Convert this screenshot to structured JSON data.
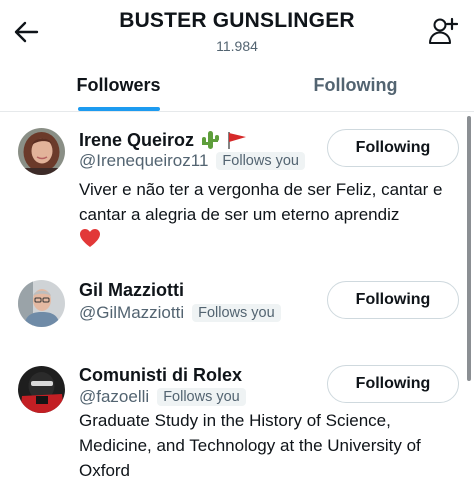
{
  "header": {
    "title": "BUSTER GUNSLINGER",
    "subtitle": "11.984"
  },
  "tabs": [
    {
      "label": "Followers",
      "active": true
    },
    {
      "label": "Following",
      "active": false
    }
  ],
  "colors": {
    "accent": "#1d9bf0",
    "secondary_text": "#536471"
  },
  "users": [
    {
      "name": "Irene Queiroz",
      "emojis": [
        "cactus",
        "red-flag"
      ],
      "handle": "@Irenequeiroz11",
      "badge": "Follows you",
      "button": "Following",
      "bio": "Viver e não ter a vergonha de ser Feliz, cantar e cantar a alegria de ser um eterno aprendiz"
    },
    {
      "name": "Gil Mazziotti",
      "handle": "@GilMazziotti",
      "badge": "Follows you",
      "button": "Following"
    },
    {
      "name": "Comunisti di Rolex",
      "handle": "@fazoelli",
      "badge": "Follows you",
      "button": "Following",
      "bio": "Graduate Study in the History of Science, Medicine, and Technology at the University of Oxford"
    }
  ]
}
